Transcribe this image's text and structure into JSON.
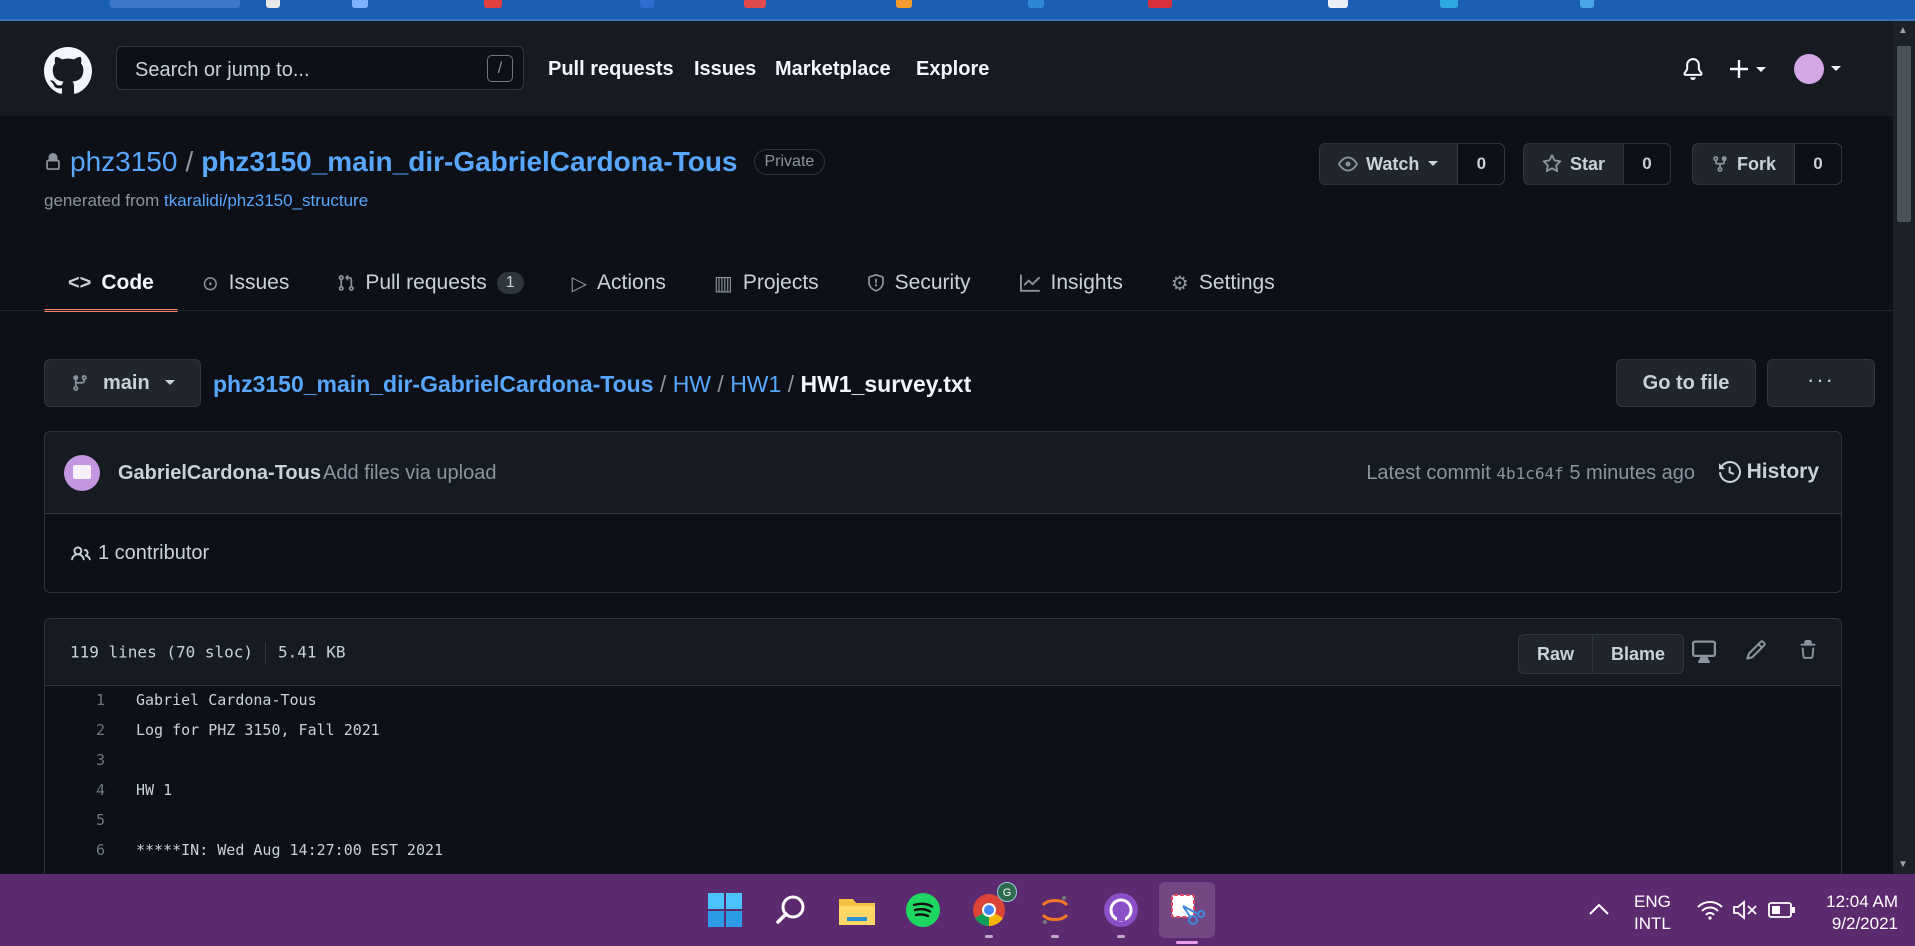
{
  "header": {
    "search_placeholder": "Search or jump to...",
    "search_shortcut": "/",
    "nav": [
      "Pull requests",
      "Issues",
      "Marketplace",
      "Explore"
    ]
  },
  "repo": {
    "owner": "phz3150",
    "separator": "/",
    "name": "phz3150_main_dir-GabrielCardona-Tous",
    "visibility": "Private",
    "generated_prefix": "generated from",
    "generated_from": "tkaralidi/phz3150_structure",
    "watch_label": "Watch",
    "watch_count": "0",
    "star_label": "Star",
    "star_count": "0",
    "fork_label": "Fork",
    "fork_count": "0"
  },
  "tabs": [
    {
      "label": "Code",
      "icon": "code-icon"
    },
    {
      "label": "Issues",
      "icon": "issue-icon"
    },
    {
      "label": "Pull requests",
      "icon": "pull-request-icon",
      "counter": "1"
    },
    {
      "label": "Actions",
      "icon": "play-icon"
    },
    {
      "label": "Projects",
      "icon": "project-icon"
    },
    {
      "label": "Security",
      "icon": "shield-icon"
    },
    {
      "label": "Insights",
      "icon": "graph-icon"
    },
    {
      "label": "Settings",
      "icon": "gear-icon"
    }
  ],
  "breadcrumb": {
    "branch": "main",
    "parts": [
      "phz3150_main_dir-GabrielCardona-Tous",
      "HW",
      "HW1"
    ],
    "separator": "/",
    "file": "HW1_survey.txt",
    "go_to_file": "Go to file",
    "more": "···"
  },
  "commit": {
    "author": "GabrielCardona-Tous",
    "message": "Add files via upload",
    "latest_prefix": "Latest commit",
    "sha": "4b1c64f",
    "time": "5 minutes ago",
    "history": "History",
    "contributors": "1 contributor"
  },
  "file": {
    "lines_info": "119 lines (70 sloc)",
    "size": "5.41 KB",
    "raw": "Raw",
    "blame": "Blame",
    "code": [
      {
        "n": "1",
        "text": "Gabriel Cardona-Tous"
      },
      {
        "n": "2",
        "text": "Log for PHZ 3150, Fall 2021"
      },
      {
        "n": "3",
        "text": ""
      },
      {
        "n": "4",
        "text": "HW 1"
      },
      {
        "n": "5",
        "text": ""
      },
      {
        "n": "6",
        "text": "*****IN: Wed Aug 14:27:00 EST 2021"
      }
    ]
  },
  "taskbar": {
    "lang_top": "ENG",
    "lang_bottom": "INTL",
    "time": "12:04 AM",
    "date": "9/2/2021",
    "chrome_badge": "G"
  },
  "colors": {
    "bg": "#0d1117",
    "header_bg": "#161b22",
    "link": "#58a6ff",
    "tab_underline": "#f78166",
    "taskbar": "#5c2a6e"
  }
}
